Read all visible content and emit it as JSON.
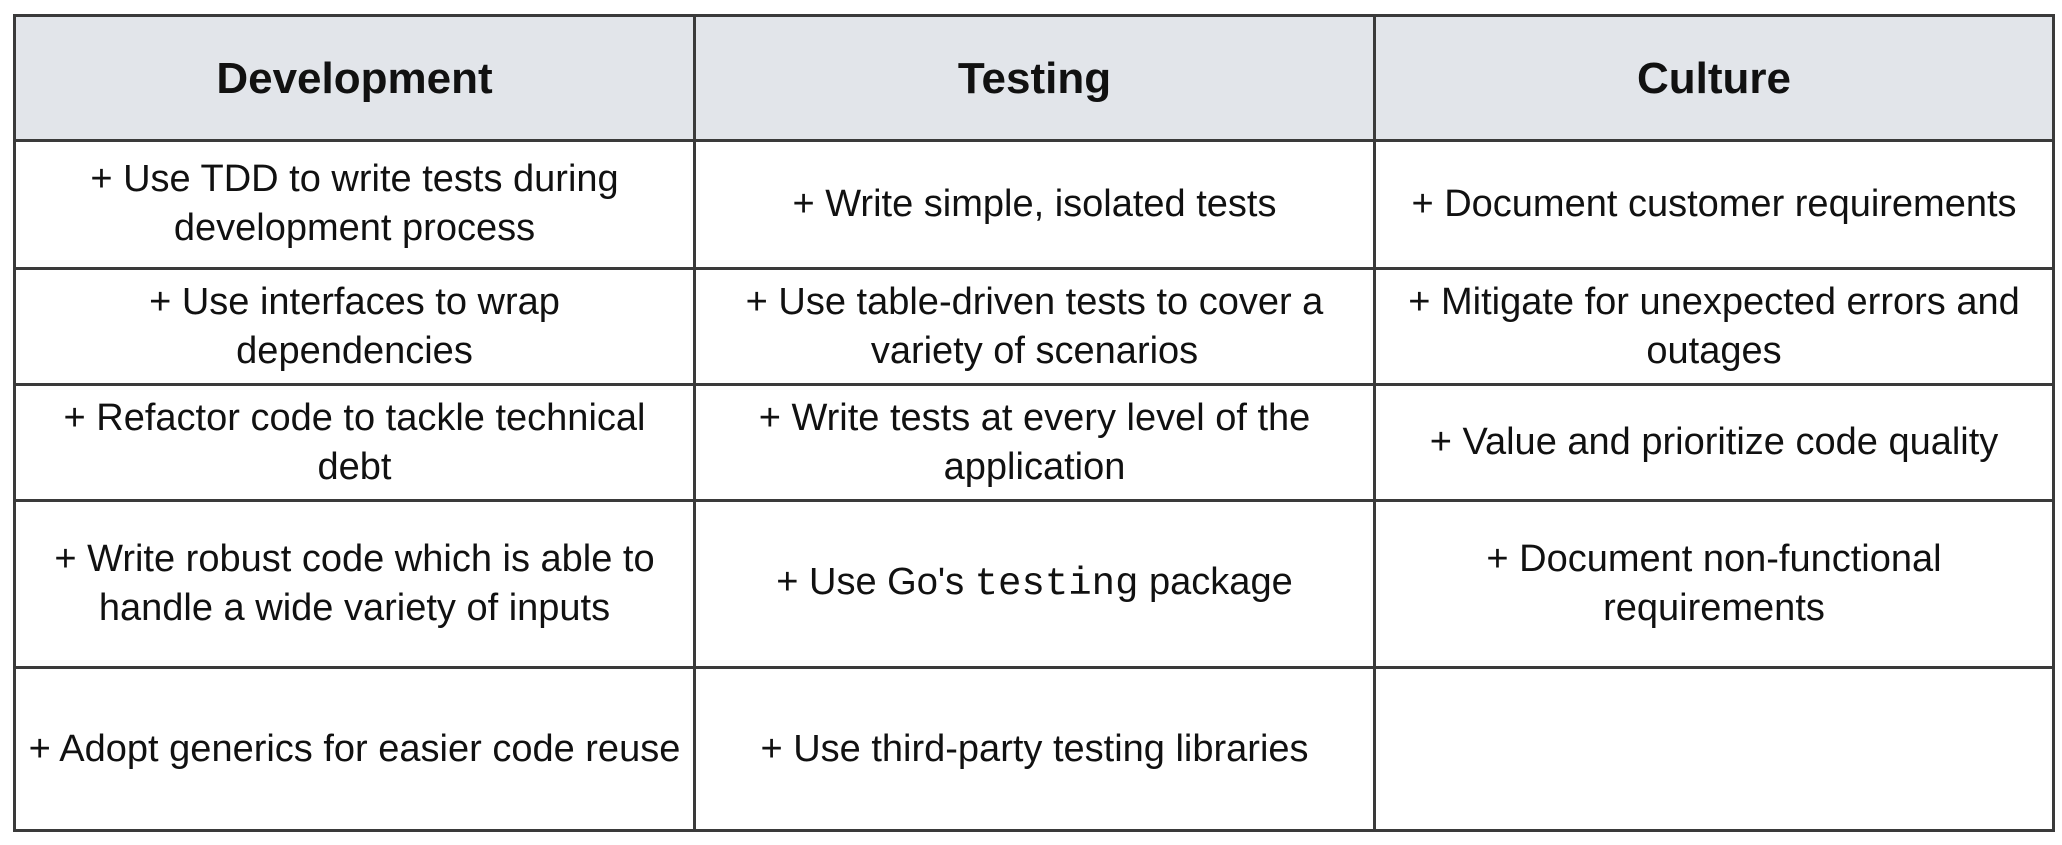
{
  "headers": {
    "development": "Development",
    "testing": "Testing",
    "culture": "Culture"
  },
  "rows": [
    {
      "development": "+ Use TDD to write tests during development process",
      "testing": "+ Write simple, isolated tests",
      "culture": "+ Document customer requirements"
    },
    {
      "development": "+ Use interfaces to wrap dependencies",
      "testing": "+ Use table-driven tests to cover a variety of scenarios",
      "culture": "+ Mitigate for unexpected errors and outages"
    },
    {
      "development": "+ Refactor code to tackle technical debt",
      "testing": "+ Write tests at every level of the application",
      "culture": "+ Value and prioritize code quality"
    },
    {
      "development": "+ Write robust code which is able to handle a wide variety of inputs",
      "testing": {
        "prefix": "+ Use Go's ",
        "code": "testing",
        "suffix": " package"
      },
      "culture": "+ Document non-functional requirements"
    },
    {
      "development": "+ Adopt generics for easier code reuse",
      "testing": "+ Use third-party testing libraries",
      "culture": ""
    }
  ]
}
